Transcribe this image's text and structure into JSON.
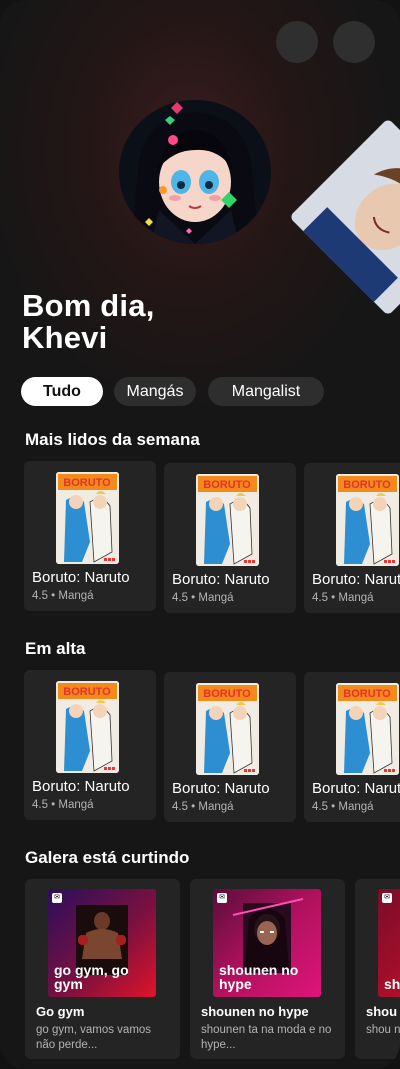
{
  "greeting": {
    "line1": "Bom dia,",
    "line2": "Khevi"
  },
  "filters": [
    "Tudo",
    "Mangás",
    "Mangalist"
  ],
  "sections": {
    "mais_lidos": {
      "title": "Mais lidos da semana",
      "cards": [
        {
          "title": "Boruto: Naruto",
          "meta": "4.5 • Mangá"
        },
        {
          "title": "Boruto: Naruto",
          "meta": "4.5 • Mangá"
        },
        {
          "title": "Boruto: Naruto",
          "meta": "4.5 • Mangá"
        }
      ]
    },
    "em_alta": {
      "title": "Em alta",
      "cards": [
        {
          "title": "Boruto: Naruto",
          "meta": "4.5 • Mangá"
        },
        {
          "title": "Boruto: Naruto",
          "meta": "4.5 • Mangá"
        },
        {
          "title": "Boruto: Naruto",
          "meta": "4.5 • Mangá"
        }
      ]
    },
    "galera": {
      "title": "Galera está curtindo",
      "playlists": [
        {
          "cover_text": "go gym, go gym",
          "title": "Go gym",
          "desc": "go gym, vamos vamos não perde..."
        },
        {
          "cover_text": "shounen no hype",
          "title": "shounen no hype",
          "desc": "shounen ta na moda e no hype..."
        },
        {
          "cover_text": "sh",
          "title": "shou",
          "desc": "shou no h"
        }
      ]
    }
  },
  "cover_logo": "BORUTO"
}
